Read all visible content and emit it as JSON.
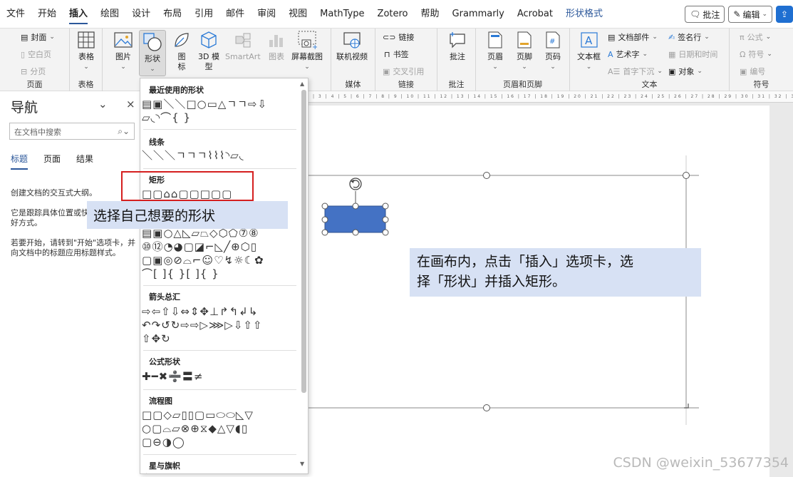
{
  "menu": {
    "tabs": [
      "文件",
      "开始",
      "插入",
      "绘图",
      "设计",
      "布局",
      "引用",
      "邮件",
      "审阅",
      "视图",
      "MathType",
      "Zotero",
      "帮助",
      "Grammarly",
      "Acrobat",
      "形状格式"
    ],
    "active_index": 2,
    "contextual_index": 15,
    "comment_btn": "批注",
    "edit_btn": "编辑"
  },
  "ribbon": {
    "pages": {
      "cover": "封面",
      "blank": "空白页",
      "break": "分页",
      "label": "页面"
    },
    "table": {
      "btn": "表格",
      "label": "表格"
    },
    "illustrations": {
      "picture": "图片",
      "shapes": "形状",
      "icons": "图\n标",
      "models": "3D 模\n型",
      "smartart": "SmartArt",
      "chart": "图表",
      "screenshot": "屏幕截图"
    },
    "media": {
      "video": "联机视频",
      "label": "媒体"
    },
    "links": {
      "link": "链接",
      "bookmark": "书签",
      "crossref": "交叉引用",
      "label": "链接"
    },
    "comments": {
      "btn": "批注",
      "label": "批注"
    },
    "header_footer": {
      "header": "页眉",
      "footer": "页脚",
      "pagenum": "页码",
      "label": "页眉和页脚"
    },
    "text": {
      "textbox": "文本框",
      "parts": "文档部件",
      "wordart": "艺术字",
      "dropcap": "首字下沉",
      "signature": "签名行",
      "datetime": "日期和时间",
      "object": "对象",
      "label": "文本"
    },
    "symbols": {
      "equation": "公式",
      "symbol": "符号",
      "number": "编号",
      "label": "符号"
    }
  },
  "nav": {
    "title": "导航",
    "search_placeholder": "在文档中搜索",
    "tabs": [
      "标题",
      "页面",
      "结果"
    ],
    "line1": "创建文档的交互式大纲。",
    "line2": "它是跟踪具体位置或快",
    "line3": "好方式。",
    "line4": "若要开始，请转到\"开始\"选项卡，并",
    "line5": "向文档中的标题应用标题样式。"
  },
  "shapes_menu": {
    "recent": "最近使用的形状",
    "lines": "线条",
    "rect": "矩形",
    "arrows": "箭头总汇",
    "equation": "公式形状",
    "flowchart": "流程图",
    "stars": "星与旗帜",
    "rows": {
      "recent1": "▤▣＼＼□○▭△ㄱㄱ⇨⇩",
      "recent2": "▱◟◝⌒{ }",
      "lines1": "＼＼＼ㄱㄱㄱ⌇⌇⌇◝▱◟",
      "rect1": "□▢⌂⌂▢▢□▢▢",
      "basic1": "▤▣○△◺▱⏢◇⬡⬠⑦⑧",
      "basic2": "⑩⑫◔◕▢◪⌐◺╱⊕⬡▯",
      "basic3": "▢▣◎⊘⌓⌐☺♡↯☼☾✿",
      "basic4": "⌒[ ]{ }[ ]{ }",
      "arrows1": "⇨⇦⇧⇩⇔⇕✥⊥↱↰↲↳",
      "arrows2": "↶↷↺↻⇨⇨▷⋙▷⇩⇧⇧",
      "arrows3": "⇧✥↻",
      "eq1": "✚━✖➗〓≠",
      "flow1": "□▢◇▱▯▯▢▭⬭⬭◺▽",
      "flow2": "○▢⌓▱⊗⊕⧖◆△▽◖▯",
      "flow3": "▢⊖◑◯",
      "stars1": "✦"
    }
  },
  "callouts": {
    "left": "选择自己想要的形状",
    "right_line1": "在画布内，点击「插入」选项卡，选",
    "right_line2": "择「形状」并插入矩形。"
  },
  "canvas": {
    "shape_fill": "#4472c4"
  },
  "watermark": "CSDN @weixin_53677354"
}
